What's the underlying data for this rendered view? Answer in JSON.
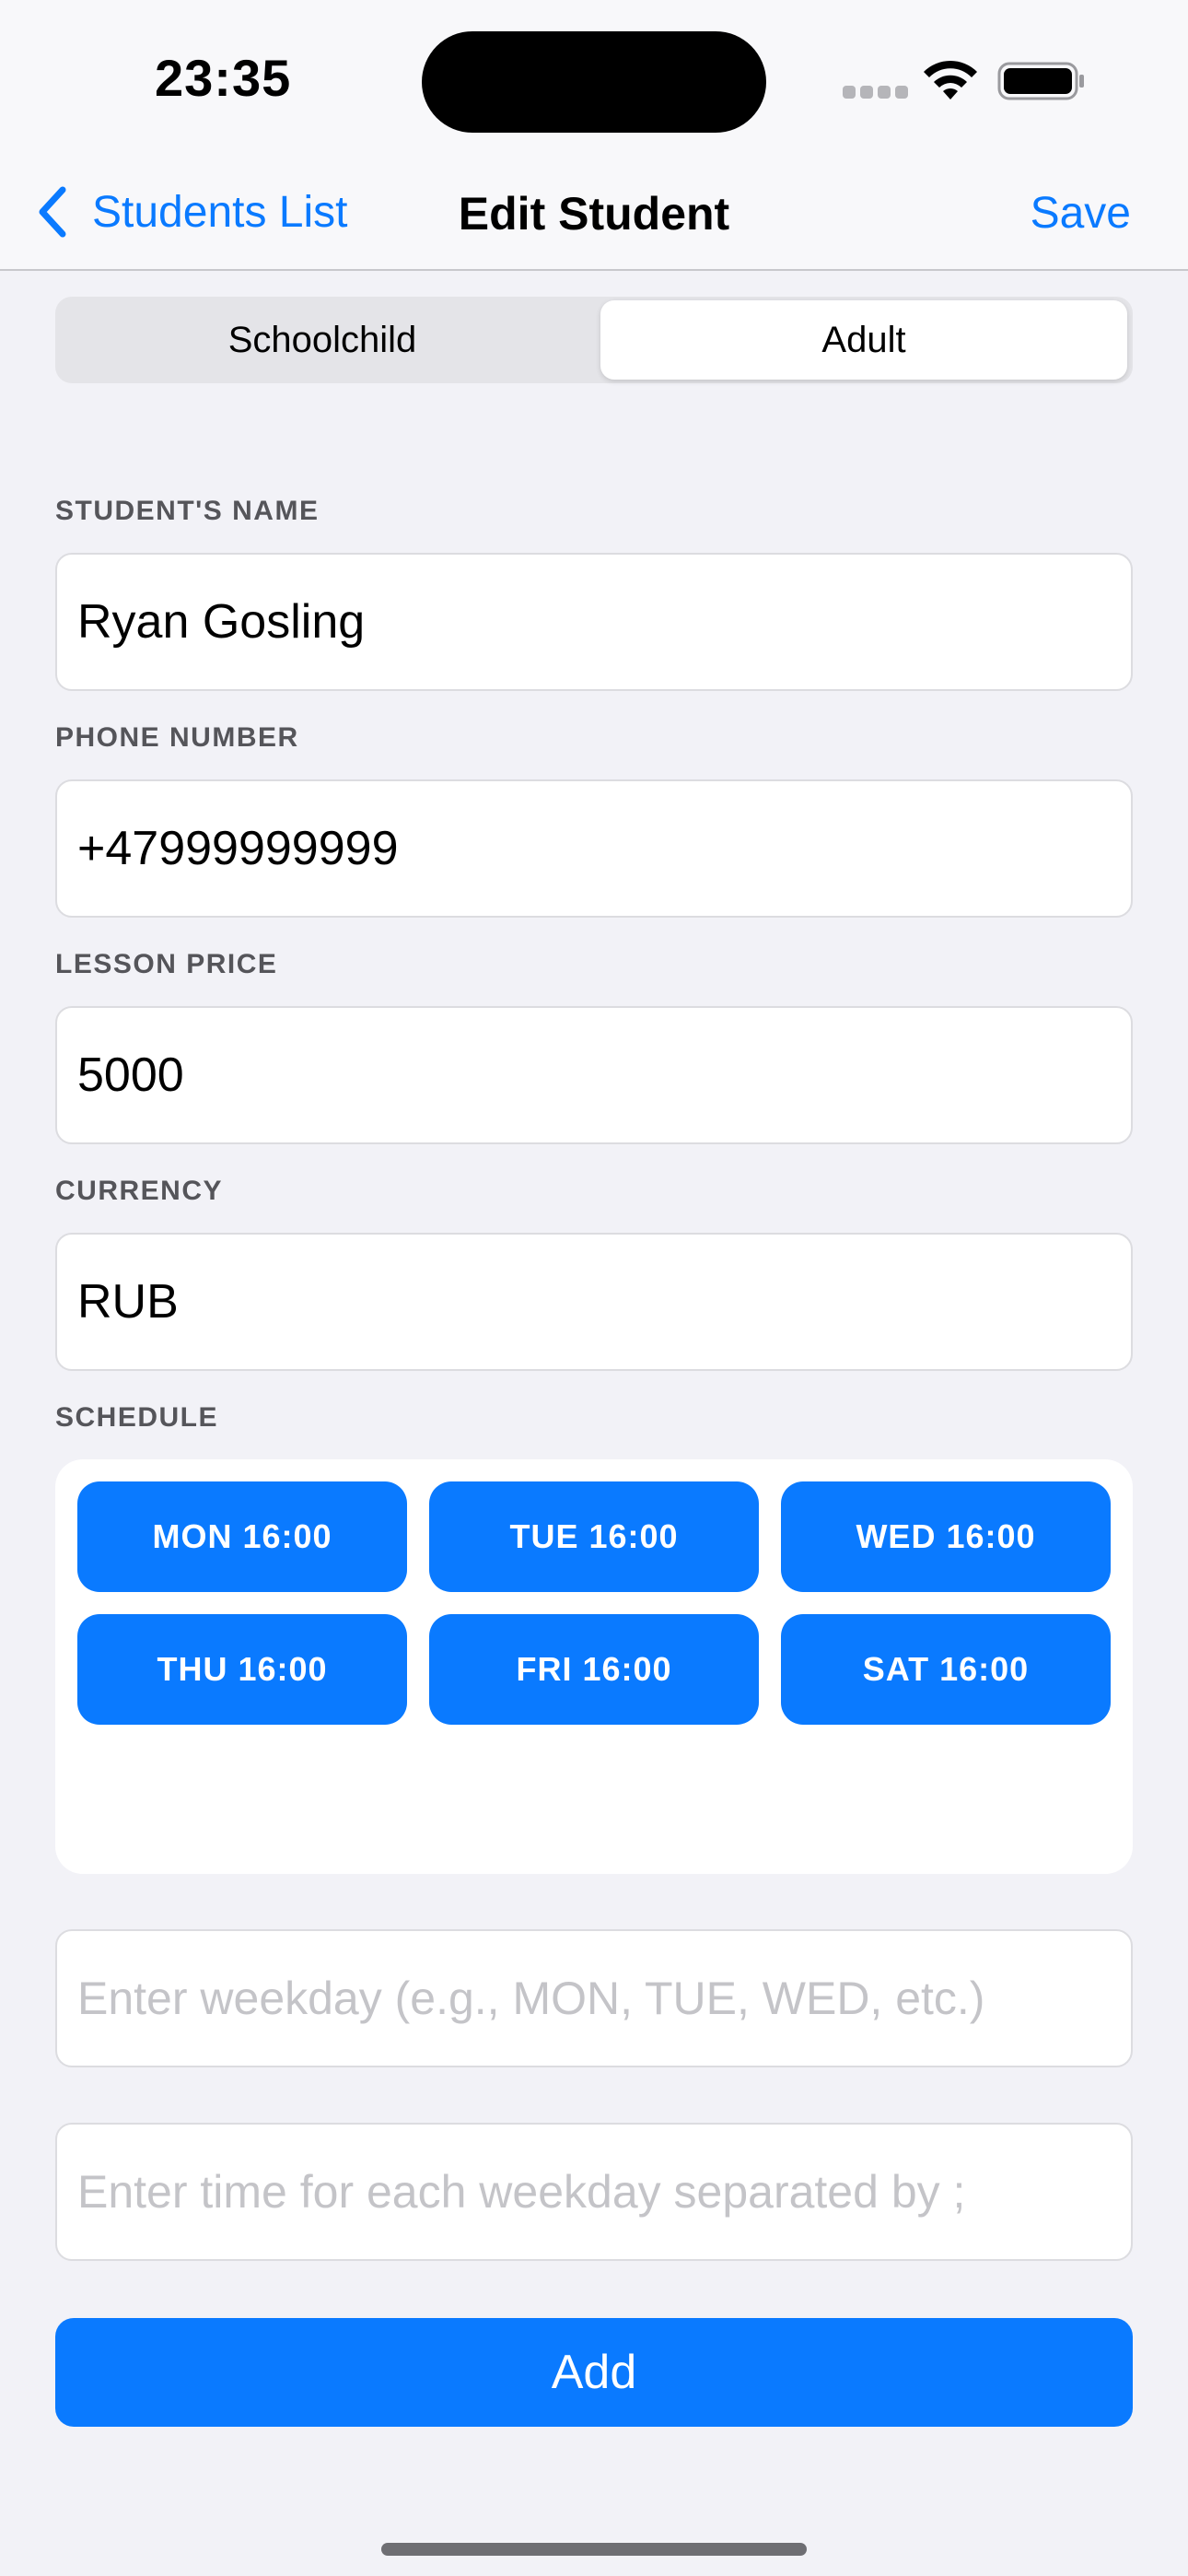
{
  "status_bar": {
    "time": "23:35"
  },
  "nav": {
    "back_label": "Students List",
    "title": "Edit Student",
    "save_label": "Save"
  },
  "segmented": {
    "options": [
      "Schoolchild",
      "Adult"
    ],
    "selected": "Adult"
  },
  "form": {
    "name_label": "STUDENT'S NAME",
    "name_value": "Ryan Gosling",
    "phone_label": "PHONE NUMBER",
    "phone_value": "+47999999999",
    "price_label": "LESSON PRICE",
    "price_value": "5000",
    "currency_label": "CURRENCY",
    "currency_value": "RUB",
    "schedule_label": "SCHEDULE"
  },
  "schedule": {
    "slots": [
      "MON 16:00",
      "TUE 16:00",
      "WED 16:00",
      "THU 16:00",
      "FRI 16:00",
      "SAT 16:00"
    ]
  },
  "inputs": {
    "weekday_placeholder": "Enter weekday (e.g., MON, TUE, WED, etc.)",
    "time_placeholder": "Enter time for each weekday separated by ;"
  },
  "add_label": "Add",
  "colors": {
    "accent": "#0a7aff",
    "background": "#f2f2f7"
  }
}
